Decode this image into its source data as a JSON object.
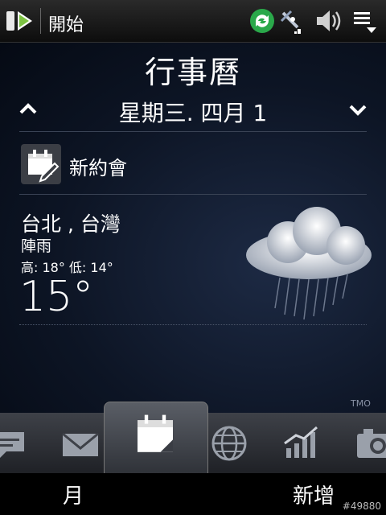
{
  "statusbar": {
    "start_label": "開始",
    "icons": [
      "windows-logo-icon",
      "sync-icon",
      "signal-icon",
      "volume-icon",
      "menu-icon"
    ]
  },
  "calendar": {
    "title": "行事曆",
    "date": "星期三. 四月 1",
    "new_appointment_label": "新約會"
  },
  "weather": {
    "city": "台北 , 台灣",
    "condition": "陣雨",
    "hilo": "高: 18° 低: 14°",
    "temperature": "15°",
    "carrier_mark": "TMO"
  },
  "tabs": [
    "chat-icon",
    "mail-icon",
    "calendar-icon",
    "globe-icon",
    "stocks-icon",
    "camera-icon"
  ],
  "softkeys": {
    "left": "月",
    "right": "新增"
  },
  "watermark": "#49880"
}
